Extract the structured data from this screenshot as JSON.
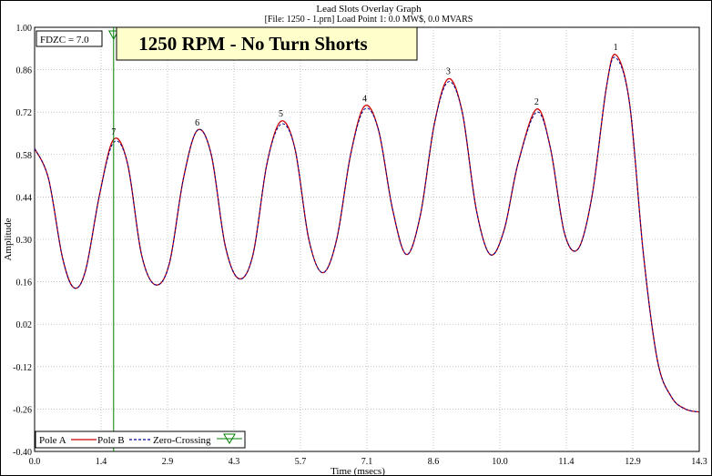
{
  "header": {
    "title": "Lead Slots Overlay Graph",
    "subtitle": "[File: 1250 - 1.prn]  Load Point 1:   0.0 MW$,    0.0 MVARS"
  },
  "annotation": {
    "fdzc_label": "FDZC =  7.0",
    "banner": "1250 RPM - No Turn Shorts"
  },
  "legend": {
    "pole_a": "Pole A",
    "pole_b": "Pole B",
    "zero_crossing": "Zero-Crossing"
  },
  "colors": {
    "pole_a": "#cc0000",
    "pole_b": "#000099",
    "zero_crossing": "#008000",
    "banner_bg": "#ffffcc",
    "grid": "#a0a0a0"
  },
  "chart_data": {
    "type": "line",
    "title": "Lead Slots Overlay Graph",
    "xlabel": "Time (msecs)",
    "ylabel": "Amplitude",
    "xlim": [
      0.0,
      14.3
    ],
    "ylim": [
      -0.4,
      1.0
    ],
    "grid": true,
    "legend_position": "bottom-left",
    "xticks": [
      "0.0",
      "1.4",
      "2.9",
      "4.3",
      "5.7",
      "7.1",
      "8.6",
      "10.0",
      "11.4",
      "12.9",
      "14.3"
    ],
    "yticks": [
      "1.00",
      "0.86",
      "0.72",
      "0.58",
      "0.44",
      "0.30",
      "0.16",
      "0.02",
      "-0.12",
      "-0.26",
      "-0.40"
    ],
    "zero_crossing_x": 1.7,
    "peak_labels": [
      {
        "label": "7",
        "x": 1.7,
        "y": 0.63
      },
      {
        "label": "6",
        "x": 3.5,
        "y": 0.66
      },
      {
        "label": "5",
        "x": 5.3,
        "y": 0.69
      },
      {
        "label": "4",
        "x": 7.1,
        "y": 0.74
      },
      {
        "label": "3",
        "x": 8.9,
        "y": 0.83
      },
      {
        "label": "2",
        "x": 10.8,
        "y": 0.73
      },
      {
        "label": "1",
        "x": 12.5,
        "y": 0.91
      }
    ],
    "series": [
      {
        "name": "Pole A",
        "x": [
          0.0,
          0.3,
          0.6,
          0.85,
          1.1,
          1.4,
          1.7,
          2.0,
          2.3,
          2.6,
          2.9,
          3.2,
          3.5,
          3.8,
          4.1,
          4.4,
          4.7,
          5.0,
          5.3,
          5.6,
          5.9,
          6.2,
          6.5,
          6.8,
          7.1,
          7.4,
          7.7,
          8.0,
          8.3,
          8.6,
          8.9,
          9.2,
          9.5,
          9.8,
          10.1,
          10.4,
          10.8,
          11.1,
          11.4,
          11.7,
          12.0,
          12.3,
          12.5,
          12.8,
          13.1,
          13.4,
          13.7,
          14.0,
          14.3
        ],
        "y": [
          0.6,
          0.5,
          0.24,
          0.14,
          0.2,
          0.45,
          0.63,
          0.55,
          0.25,
          0.15,
          0.22,
          0.5,
          0.66,
          0.58,
          0.28,
          0.17,
          0.25,
          0.55,
          0.69,
          0.6,
          0.3,
          0.19,
          0.3,
          0.58,
          0.74,
          0.66,
          0.4,
          0.25,
          0.38,
          0.68,
          0.83,
          0.72,
          0.4,
          0.25,
          0.33,
          0.55,
          0.73,
          0.6,
          0.32,
          0.27,
          0.45,
          0.8,
          0.91,
          0.75,
          0.25,
          -0.1,
          -0.22,
          -0.26,
          -0.27
        ]
      },
      {
        "name": "Pole B",
        "x": [
          0.0,
          0.3,
          0.6,
          0.85,
          1.1,
          1.4,
          1.7,
          2.0,
          2.3,
          2.6,
          2.9,
          3.2,
          3.5,
          3.8,
          4.1,
          4.4,
          4.7,
          5.0,
          5.3,
          5.6,
          5.9,
          6.2,
          6.5,
          6.8,
          7.1,
          7.4,
          7.7,
          8.0,
          8.3,
          8.6,
          8.9,
          9.2,
          9.5,
          9.8,
          10.1,
          10.4,
          10.8,
          11.1,
          11.4,
          11.7,
          12.0,
          12.3,
          12.5,
          12.8,
          13.1,
          13.4,
          13.7,
          14.0,
          14.3
        ],
        "y": [
          0.6,
          0.5,
          0.24,
          0.14,
          0.2,
          0.45,
          0.62,
          0.55,
          0.25,
          0.15,
          0.22,
          0.5,
          0.66,
          0.58,
          0.28,
          0.17,
          0.25,
          0.55,
          0.68,
          0.6,
          0.3,
          0.19,
          0.3,
          0.58,
          0.73,
          0.66,
          0.4,
          0.25,
          0.38,
          0.68,
          0.82,
          0.72,
          0.4,
          0.25,
          0.33,
          0.55,
          0.72,
          0.6,
          0.32,
          0.27,
          0.45,
          0.8,
          0.9,
          0.75,
          0.25,
          -0.1,
          -0.22,
          -0.26,
          -0.27
        ]
      }
    ]
  }
}
